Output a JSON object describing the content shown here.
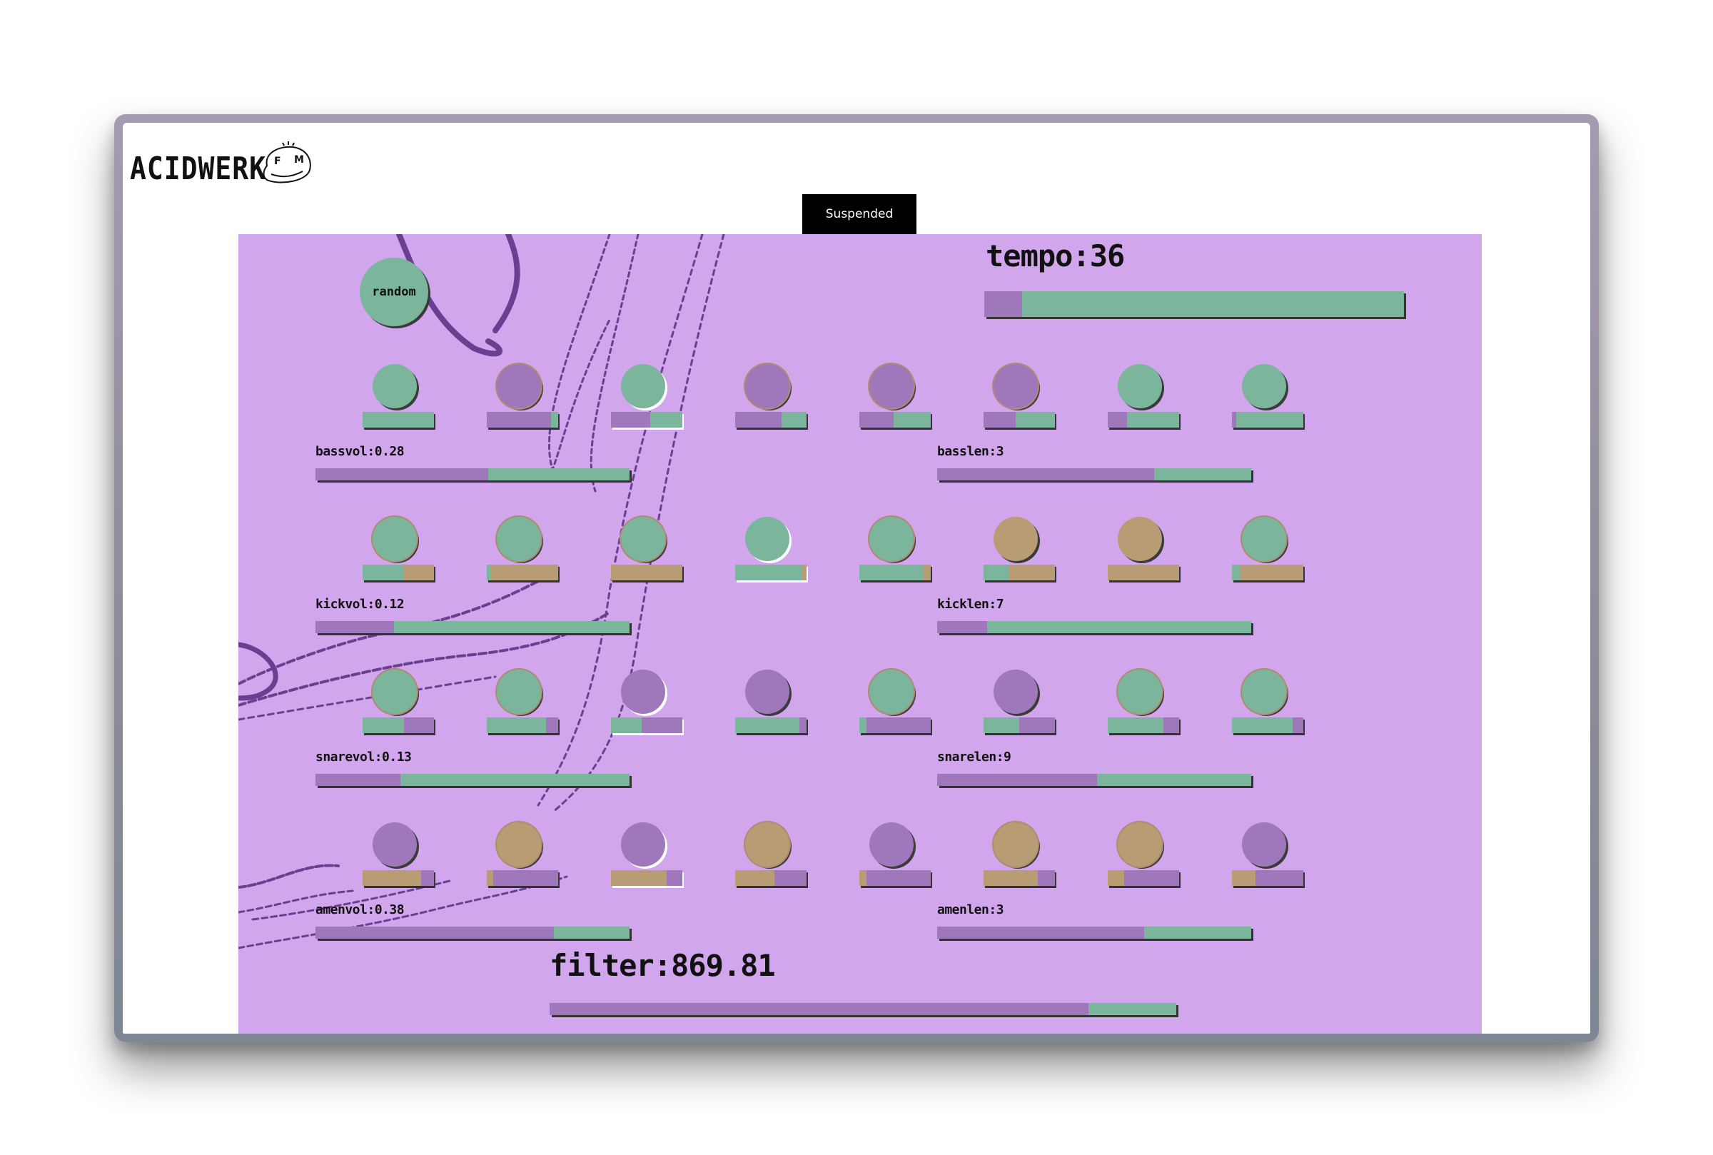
{
  "app": {
    "logo_text": "ACIDWERK",
    "status_button": "Suspended",
    "random_button": "random"
  },
  "colors": {
    "stage_bg": "#d1a6ec",
    "green": "#7bb59c",
    "purple": "#9f78bb",
    "tan": "#b79c74",
    "doodle": "#6a3f92"
  },
  "tempo": {
    "label": "tempo:36",
    "level": 0.09
  },
  "filter": {
    "label": "filter:869.81",
    "level": 0.86
  },
  "tracks": [
    {
      "name": "bass",
      "vol_label": "bassvol:0.28",
      "vol_level": 0.55,
      "len_label": "basslen:3",
      "len_level": 0.69,
      "active_step": 2,
      "steps": [
        {
          "knob": "green",
          "ring": false,
          "bar_fill": "purple",
          "bar_rest": "green",
          "level": 0.0
        },
        {
          "knob": "purple",
          "ring": true,
          "bar_fill": "purple",
          "bar_rest": "green",
          "level": 0.9
        },
        {
          "knob": "green",
          "ring": false,
          "bar_fill": "purple",
          "bar_rest": "green",
          "level": 0.55
        },
        {
          "knob": "purple",
          "ring": true,
          "bar_fill": "purple",
          "bar_rest": "green",
          "level": 0.65
        },
        {
          "knob": "purple",
          "ring": true,
          "bar_fill": "purple",
          "bar_rest": "green",
          "level": 0.48
        },
        {
          "knob": "purple",
          "ring": true,
          "bar_fill": "purple",
          "bar_rest": "green",
          "level": 0.45
        },
        {
          "knob": "green",
          "ring": false,
          "bar_fill": "purple",
          "bar_rest": "green",
          "level": 0.27
        },
        {
          "knob": "green",
          "ring": false,
          "bar_fill": "purple",
          "bar_rest": "green",
          "level": 0.06
        }
      ]
    },
    {
      "name": "kick",
      "vol_label": "kickvol:0.12",
      "vol_level": 0.25,
      "len_label": "kicklen:7",
      "len_level": 0.16,
      "active_step": 3,
      "steps": [
        {
          "knob": "green",
          "ring": true,
          "bar_fill": "green",
          "bar_rest": "tan",
          "level": 0.57
        },
        {
          "knob": "green",
          "ring": true,
          "bar_fill": "green",
          "bar_rest": "tan",
          "level": 0.05
        },
        {
          "knob": "green",
          "ring": true,
          "bar_fill": "green",
          "bar_rest": "tan",
          "level": 0.0
        },
        {
          "knob": "green",
          "ring": false,
          "bar_fill": "green",
          "bar_rest": "tan",
          "level": 0.93
        },
        {
          "knob": "green",
          "ring": true,
          "bar_fill": "green",
          "bar_rest": "tan",
          "level": 0.9
        },
        {
          "knob": "tan",
          "ring": false,
          "bar_fill": "green",
          "bar_rest": "tan",
          "level": 0.35
        },
        {
          "knob": "tan",
          "ring": false,
          "bar_fill": "green",
          "bar_rest": "tan",
          "level": 0.0
        },
        {
          "knob": "green",
          "ring": true,
          "bar_fill": "green",
          "bar_rest": "tan",
          "level": 0.12
        }
      ]
    },
    {
      "name": "snare",
      "vol_label": "snarevol:0.13",
      "vol_level": 0.27,
      "len_label": "snarelen:9",
      "len_level": 0.51,
      "active_step": 2,
      "steps": [
        {
          "knob": "green",
          "ring": true,
          "bar_fill": "green",
          "bar_rest": "purple",
          "level": 0.58
        },
        {
          "knob": "green",
          "ring": true,
          "bar_fill": "green",
          "bar_rest": "purple",
          "level": 0.83
        },
        {
          "knob": "purple",
          "ring": false,
          "bar_fill": "green",
          "bar_rest": "purple",
          "level": 0.43
        },
        {
          "knob": "purple",
          "ring": false,
          "bar_fill": "green",
          "bar_rest": "purple",
          "level": 0.9
        },
        {
          "knob": "green",
          "ring": true,
          "bar_fill": "green",
          "bar_rest": "purple",
          "level": 0.1
        },
        {
          "knob": "purple",
          "ring": false,
          "bar_fill": "green",
          "bar_rest": "purple",
          "level": 0.5
        },
        {
          "knob": "green",
          "ring": true,
          "bar_fill": "green",
          "bar_rest": "purple",
          "level": 0.78
        },
        {
          "knob": "green",
          "ring": true,
          "bar_fill": "green",
          "bar_rest": "purple",
          "level": 0.85
        }
      ]
    },
    {
      "name": "amen",
      "vol_label": "amenvol:0.38",
      "vol_level": 0.76,
      "len_label": "amenlen:3",
      "len_level": 0.66,
      "active_step": 2,
      "steps": [
        {
          "knob": "purple",
          "ring": false,
          "bar_fill": "tan",
          "bar_rest": "purple",
          "level": 0.82
        },
        {
          "knob": "tan",
          "ring": true,
          "bar_fill": "tan",
          "bar_rest": "purple",
          "level": 0.09
        },
        {
          "knob": "purple",
          "ring": false,
          "bar_fill": "tan",
          "bar_rest": "purple",
          "level": 0.78
        },
        {
          "knob": "tan",
          "ring": true,
          "bar_fill": "tan",
          "bar_rest": "purple",
          "level": 0.55
        },
        {
          "knob": "purple",
          "ring": false,
          "bar_fill": "tan",
          "bar_rest": "purple",
          "level": 0.1
        },
        {
          "knob": "tan",
          "ring": true,
          "bar_fill": "tan",
          "bar_rest": "purple",
          "level": 0.76
        },
        {
          "knob": "tan",
          "ring": true,
          "bar_fill": "tan",
          "bar_rest": "purple",
          "level": 0.23
        },
        {
          "knob": "purple",
          "ring": false,
          "bar_fill": "tan",
          "bar_rest": "purple",
          "level": 0.33
        }
      ]
    }
  ]
}
